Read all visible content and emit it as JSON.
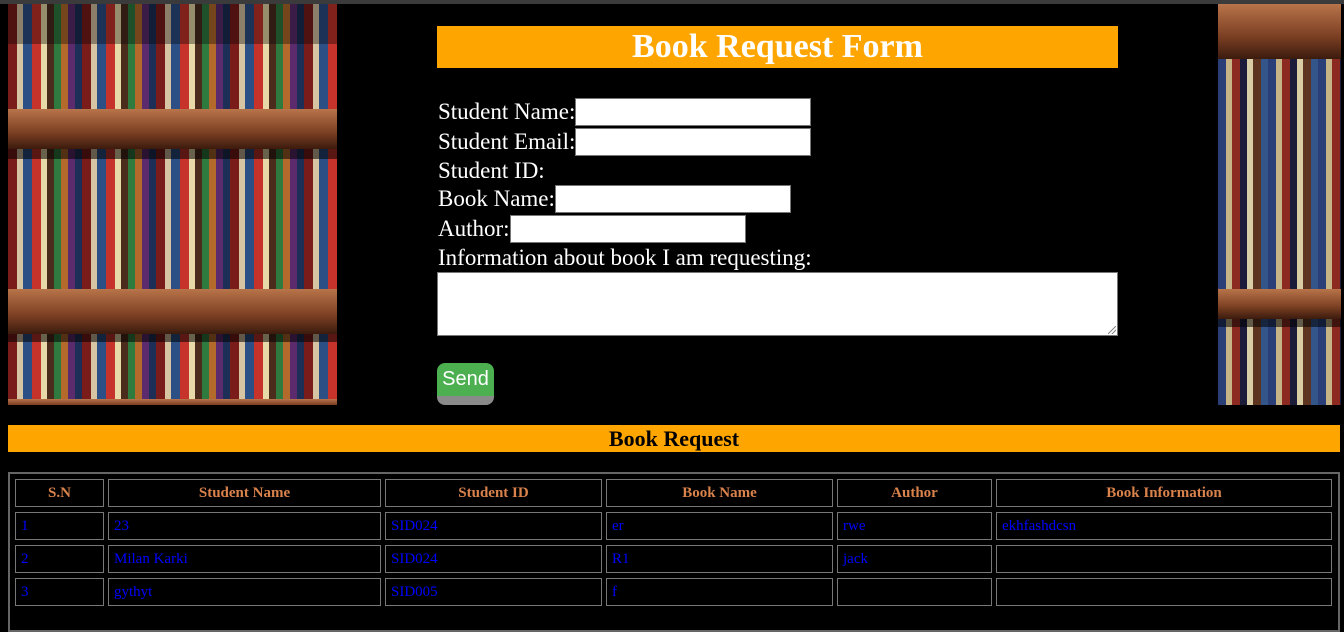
{
  "form": {
    "title": "Book Request Form",
    "student_name_label": "Student Name:",
    "student_email_label": "Student Email:",
    "student_id_label": "Student ID:",
    "book_name_label": "Book Name:",
    "author_label": "Author:",
    "info_label": "Information about book I am requesting:",
    "send_label": "Send",
    "student_name_value": "",
    "student_email_value": "",
    "book_name_value": "",
    "author_value": "",
    "info_value": ""
  },
  "section_title": "Book Request",
  "table": {
    "headers": [
      "S.N",
      "Student Name",
      "Student ID",
      "Book Name",
      "Author",
      "Book Information"
    ],
    "rows": [
      [
        "1",
        "23",
        "SID024",
        "er",
        "rwe",
        "ekhfashdcsn"
      ],
      [
        "2",
        "Milan Karki",
        "SID024",
        "R1",
        "jack",
        ""
      ],
      [
        "3",
        "gythyt",
        "SID005",
        "f",
        "",
        ""
      ]
    ]
  },
  "colors": {
    "accent": "#ffa500",
    "button": "#4caf50",
    "table_header_text": "#d9824b",
    "table_cell_text": "#0000ff"
  }
}
